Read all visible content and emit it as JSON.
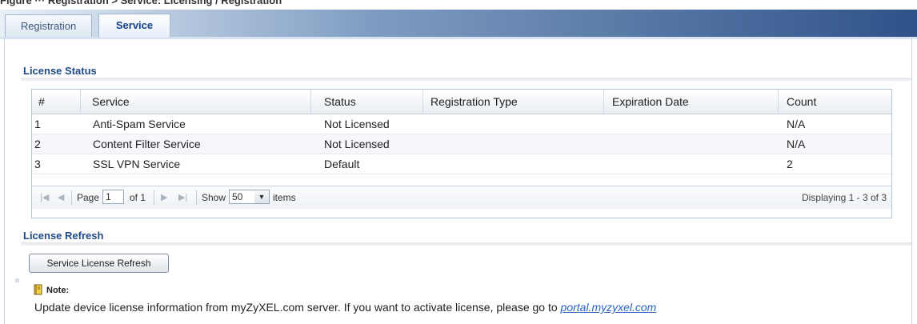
{
  "figure_caption": "Figure ··· Registration > Service: Licensing / Registration",
  "tabs": [
    {
      "label": "Registration",
      "active": false
    },
    {
      "label": "Service",
      "active": true
    }
  ],
  "license_status": {
    "title": "License Status",
    "columns": [
      "#",
      "Service",
      "Status",
      "Registration Type",
      "Expiration Date",
      "Count"
    ],
    "rows": [
      {
        "num": "1",
        "service": "Anti-Spam Service",
        "status": "Not Licensed",
        "registration_type": "",
        "expiration_date": "",
        "count": "N/A"
      },
      {
        "num": "2",
        "service": "Content Filter Service",
        "status": "Not Licensed",
        "registration_type": "",
        "expiration_date": "",
        "count": "N/A"
      },
      {
        "num": "3",
        "service": "SSL VPN Service",
        "status": "Default",
        "registration_type": "",
        "expiration_date": "",
        "count": "2"
      }
    ],
    "pager": {
      "page_label": "Page",
      "page_value": "1",
      "of_label": "of 1",
      "show_label": "Show",
      "show_value": "50",
      "items_label": "items",
      "displaying": "Displaying 1 - 3 of 3"
    }
  },
  "license_refresh": {
    "title": "License Refresh",
    "button_label": "Service License Refresh"
  },
  "note": {
    "label": "Note:",
    "text": "Update device license information from myZyXEL.com server. If you want to activate license, please go to ",
    "link": "portal.myzyxel.com"
  },
  "colors": {
    "accent": "#1f4a85",
    "link": "#2a63c5",
    "tabbar_dark": "#2f5289"
  }
}
